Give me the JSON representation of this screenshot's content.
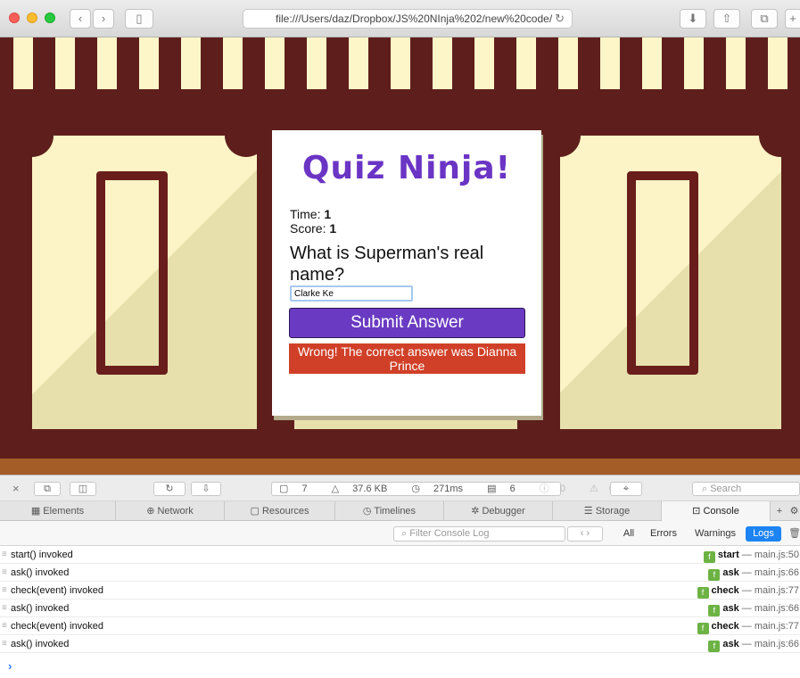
{
  "browser": {
    "url": "file:///Users/daz/Dropbox/JS%20NInja%202/new%20code/",
    "back_icon": "chevron-left-icon",
    "forward_icon": "chevron-right-icon"
  },
  "quiz": {
    "title": "Quiz Ninja!",
    "time_label": "Time:",
    "time_value": "1",
    "score_label": "Score:",
    "score_value": "1",
    "question": "What is Superman's real name?",
    "answer_value": "Clarke Ke",
    "submit_label": "Submit Answer",
    "feedback": "Wrong! The correct answer was Dianna Prince",
    "title_color": "#6a34c4",
    "submit_color": "#6a3bc2",
    "feedback_color": "#d04028"
  },
  "devtools": {
    "stats": {
      "resources": "7",
      "size": "37.6 KB",
      "time": "271ms",
      "logs": "6",
      "errors": "0",
      "warnings": "0"
    },
    "search_placeholder": "Search",
    "tabs": [
      {
        "label": "Elements"
      },
      {
        "label": "Network"
      },
      {
        "label": "Resources"
      },
      {
        "label": "Timelines"
      },
      {
        "label": "Debugger"
      },
      {
        "label": "Storage"
      },
      {
        "label": "Console"
      }
    ],
    "filter_placeholder": "Filter Console Log",
    "filters": {
      "all": "All",
      "errors": "Errors",
      "warnings": "Warnings",
      "logs": "Logs"
    },
    "rows": [
      {
        "message": "start() invoked",
        "fn": "start",
        "location": "main.js:50"
      },
      {
        "message": "ask() invoked",
        "fn": "ask",
        "location": "main.js:66"
      },
      {
        "message": "check(event) invoked",
        "fn": "check",
        "location": "main.js:77"
      },
      {
        "message": "ask() invoked",
        "fn": "ask",
        "location": "main.js:66"
      },
      {
        "message": "check(event) invoked",
        "fn": "check",
        "location": "main.js:77"
      },
      {
        "message": "ask() invoked",
        "fn": "ask",
        "location": "main.js:66"
      }
    ],
    "prompt": "›"
  }
}
